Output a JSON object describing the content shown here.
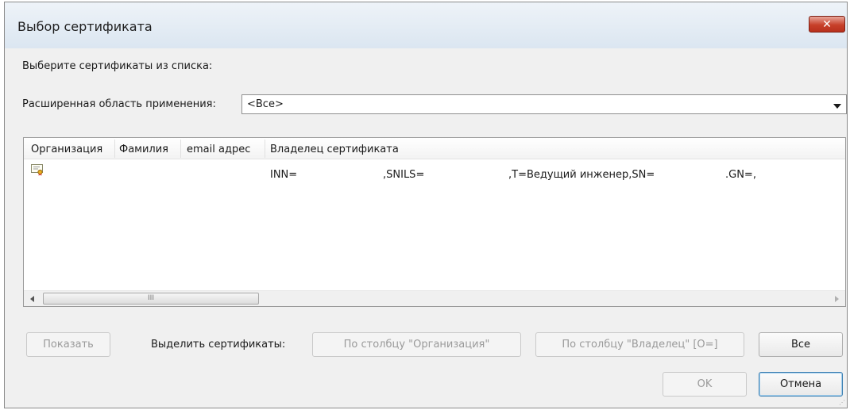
{
  "window": {
    "title": "Выбор сертификата",
    "close_label": "✕"
  },
  "prompt": "Выберите сертификаты из списка:",
  "scope": {
    "label": "Расширенная область применения:",
    "value": "<Все>"
  },
  "table": {
    "columns": [
      "Организация",
      "Фамилия",
      "email адрес",
      "Владелец сертификата"
    ],
    "rows": [
      {
        "icon": "certificate-icon",
        "organization": "",
        "surname": "",
        "email": "",
        "owner_parts": [
          "INN=",
          ",SNILS=",
          ",T=Ведущий инженер,SN=",
          ".GN=,"
        ]
      }
    ],
    "scrollbar_thumb_label": "III"
  },
  "actions": {
    "show_label": "Показать",
    "select_label": "Выделить сертификаты:",
    "by_org_label": "По столбцу \"Организация\"",
    "by_owner_label": "По столбцу \"Владелец\" [O=]",
    "all_label": "Все",
    "ok_label": "OK",
    "cancel_label": "Отмена"
  },
  "colors": {
    "close_button": "#c7402a",
    "default_button_border": "#3c7fb1",
    "dialog_bg": "#f0f0f0"
  }
}
